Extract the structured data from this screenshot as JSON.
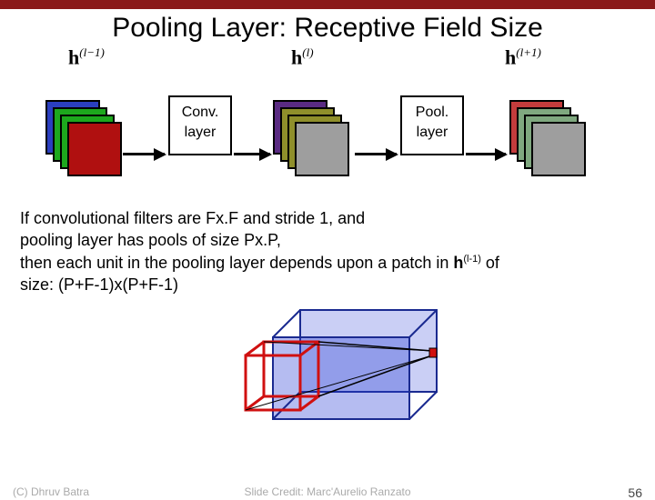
{
  "title": "Pooling Layer: Receptive Field Size",
  "layers": {
    "h_prev": {
      "base": "h",
      "sup": "(l−1)"
    },
    "h_cur": {
      "base": "h",
      "sup": "(l)"
    },
    "h_next": {
      "base": "h",
      "sup": "(l+1)"
    }
  },
  "ops": {
    "conv": {
      "line1": "Conv.",
      "line2": "layer"
    },
    "pool": {
      "line1": "Pool.",
      "line2": "layer"
    }
  },
  "stacks": {
    "stack1_colors": [
      "#2b3fbf",
      "#1da81d",
      "#1da81d",
      "#b01010"
    ],
    "stack2_colors": [
      "#5a2b82",
      "#8f8f2b",
      "#8f8f2b",
      "#9e9e9e"
    ],
    "stack3_colors": [
      "#c43c3c",
      "#7fa87f",
      "#7fa87f",
      "#9e9e9e"
    ]
  },
  "body": {
    "line1": "If convolutional filters are Fx.F and stride 1, and",
    "line2": "pooling layer has pools of size Px.P,",
    "line3a": "then each unit in the pooling layer depends upon a patch in ",
    "line3b_base": "h",
    "line3b_sup": "(l-1)",
    "line3c": " of",
    "line4": "size: (P+F-1)x(P+F-1)"
  },
  "footer": {
    "left": "(C) Dhruv Batra",
    "center": "Slide Credit: Marc'Aurelio Ranzato",
    "right": "56"
  }
}
